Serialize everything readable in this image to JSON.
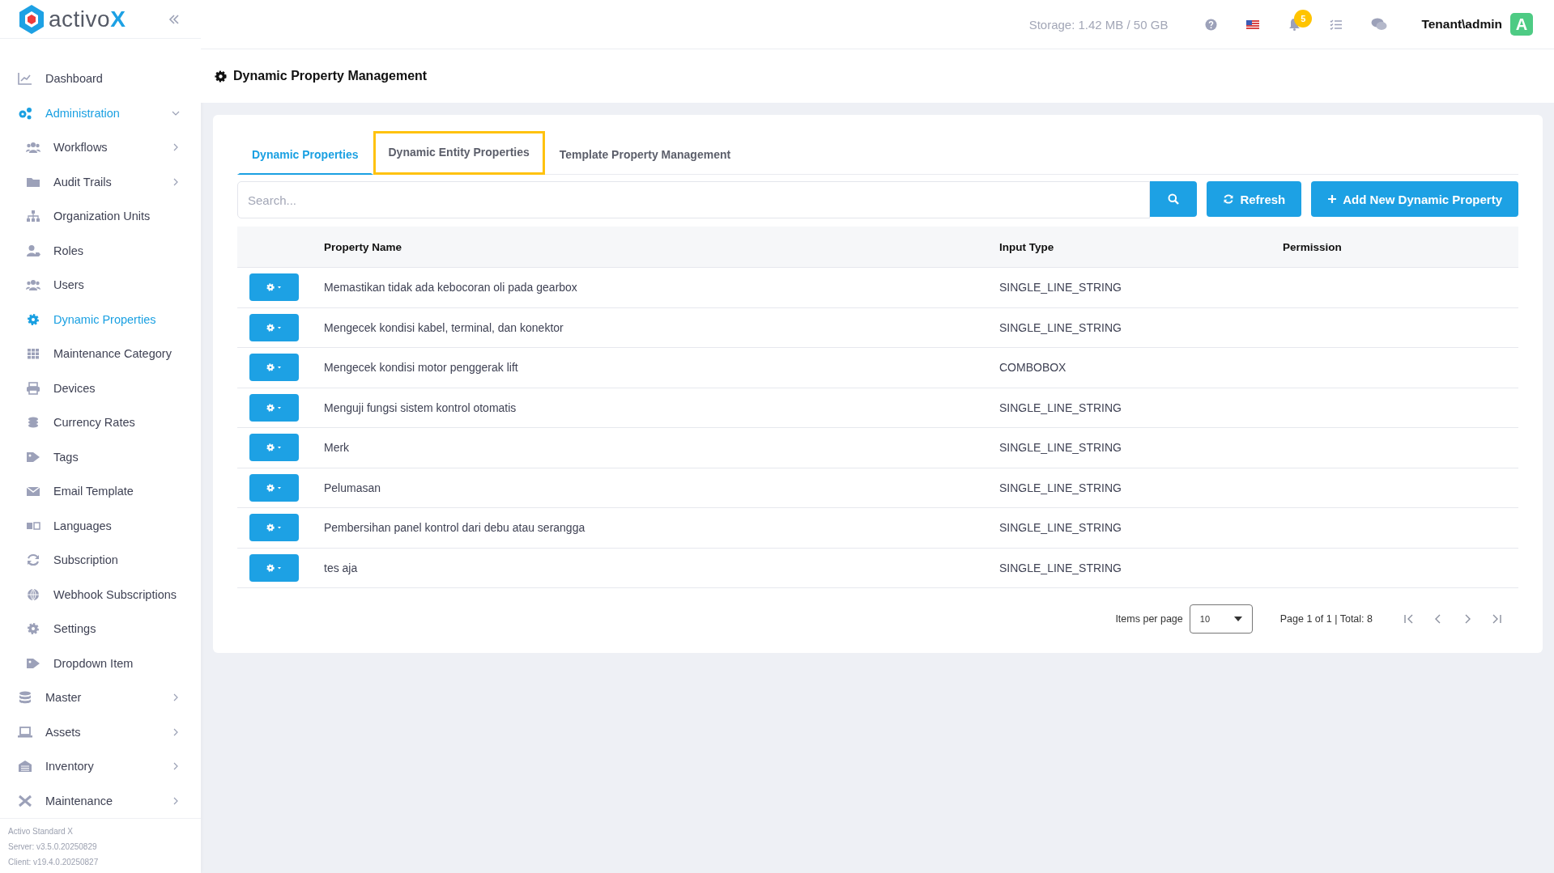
{
  "sidebar": {
    "logo": {
      "text": "activo",
      "accent": "X"
    },
    "items": [
      {
        "label": "Dashboard",
        "kind": "top",
        "selected": false
      },
      {
        "label": "Administration",
        "kind": "top",
        "selected": true,
        "expanded": true
      },
      {
        "label": "Workflows",
        "kind": "sub",
        "selected": false,
        "expanded": false
      },
      {
        "label": "Audit Trails",
        "kind": "sub",
        "selected": false,
        "expanded": false
      },
      {
        "label": "Organization Units",
        "kind": "sub",
        "selected": false
      },
      {
        "label": "Roles",
        "kind": "sub",
        "selected": false
      },
      {
        "label": "Users",
        "kind": "sub",
        "selected": false
      },
      {
        "label": "Dynamic Properties",
        "kind": "sub",
        "selected": true
      },
      {
        "label": "Maintenance Category",
        "kind": "sub",
        "selected": false
      },
      {
        "label": "Devices",
        "kind": "sub",
        "selected": false
      },
      {
        "label": "Currency Rates",
        "kind": "sub",
        "selected": false
      },
      {
        "label": "Tags",
        "kind": "sub",
        "selected": false
      },
      {
        "label": "Email Template",
        "kind": "sub",
        "selected": false
      },
      {
        "label": "Languages",
        "kind": "sub",
        "selected": false
      },
      {
        "label": "Subscription",
        "kind": "sub",
        "selected": false
      },
      {
        "label": "Webhook Subscriptions",
        "kind": "sub",
        "selected": false
      },
      {
        "label": "Settings",
        "kind": "sub",
        "selected": false
      },
      {
        "label": "Dropdown Item",
        "kind": "sub",
        "selected": false
      },
      {
        "label": "Master",
        "kind": "top",
        "selected": false,
        "expanded": false
      },
      {
        "label": "Assets",
        "kind": "top",
        "selected": false,
        "expanded": false
      },
      {
        "label": "Inventory",
        "kind": "top",
        "selected": false,
        "expanded": false
      },
      {
        "label": "Maintenance",
        "kind": "top",
        "selected": false,
        "expanded": false
      }
    ],
    "footer": [
      "Activo Standard X",
      "Server: v3.5.0.20250829",
      "Client: v19.4.0.20250827"
    ]
  },
  "header": {
    "storage": "Storage: 1.42 MB / 50 GB",
    "notifications": "5",
    "user": "Tenant\\admin",
    "avatar": "A"
  },
  "page_title": "Dynamic Property Management",
  "tabs": [
    {
      "label": "Dynamic Properties",
      "selected": true,
      "highlighted": false
    },
    {
      "label": "Dynamic Entity Properties",
      "selected": false,
      "highlighted": true
    },
    {
      "label": "Template Property Management",
      "selected": false,
      "highlighted": false
    }
  ],
  "search": {
    "placeholder": "Search..."
  },
  "buttons": [
    "Refresh",
    "Add New Dynamic Property"
  ],
  "table": {
    "columns": [
      "Property Name",
      "Input Type",
      "Permission"
    ],
    "rows": [
      {
        "property_name": "Memastikan tidak ada kebocoran oli pada gearbox",
        "input_type": "SINGLE_LINE_STRING"
      },
      {
        "property_name": "Mengecek kondisi kabel, terminal, dan konektor",
        "input_type": "SINGLE_LINE_STRING"
      },
      {
        "property_name": "Mengecek kondisi motor penggerak lift",
        "input_type": "COMBOBOX"
      },
      {
        "property_name": "Menguji fungsi sistem kontrol otomatis",
        "input_type": "SINGLE_LINE_STRING"
      },
      {
        "property_name": "Merk",
        "input_type": "SINGLE_LINE_STRING"
      },
      {
        "property_name": "Pelumasan",
        "input_type": "SINGLE_LINE_STRING"
      },
      {
        "property_name": "Pembersihan panel kontrol dari debu atau serangga",
        "input_type": "SINGLE_LINE_STRING"
      },
      {
        "property_name": "tes aja",
        "input_type": "SINGLE_LINE_STRING"
      }
    ]
  },
  "pagination": {
    "items_per_page_label": "Items per page",
    "items_per_page": "10",
    "summary": "Page 1 of 1 | Total: 8"
  }
}
